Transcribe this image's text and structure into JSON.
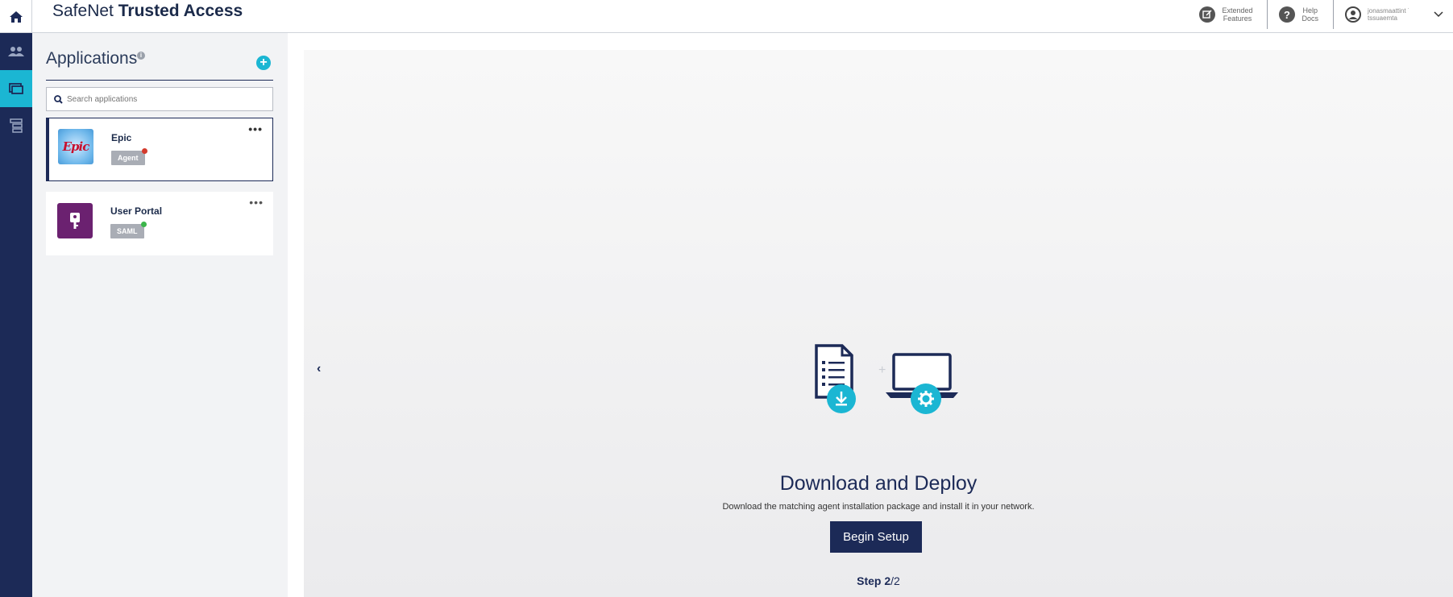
{
  "header": {
    "brand_light": "SafeNet",
    "brand_bold": "Trusted Access",
    "extended_features_line1": "Extended",
    "extended_features_line2": "Features",
    "help_docs_line1": "Help",
    "help_docs_line2": "Docs",
    "user_line1": "jonasmaattint ˙",
    "user_line2": "tssuaemta",
    "icons": [
      "home-icon",
      "external-edit-icon",
      "help-icon",
      "user-avatar-icon",
      "chevron-down-icon"
    ]
  },
  "rail": {
    "items": [
      {
        "name": "users-icon",
        "active": false
      },
      {
        "name": "applications-icon",
        "active": true
      },
      {
        "name": "policies-icon",
        "active": false
      }
    ]
  },
  "sidebar": {
    "title": "Applications",
    "info_glyph": "i",
    "add_glyph": "+",
    "search_placeholder": "Search applications",
    "apps": [
      {
        "name": "Epic",
        "badge": "Agent",
        "status_color": "#d33a2c",
        "logo_text": "Epic",
        "selected": true,
        "more": "•••"
      },
      {
        "name": "User Portal",
        "badge": "SAML",
        "status_color": "#3bb54a",
        "logo_text": "",
        "selected": false,
        "more": "•••"
      }
    ]
  },
  "main": {
    "prev_glyph": "‹",
    "title": "Download and Deploy",
    "description": "Download the matching agent installation package and install it in your network.",
    "begin_button": "Begin Setup",
    "step_label": "Step 2",
    "step_total": "/2",
    "plus_glyph": "+"
  },
  "colors": {
    "navy": "#1c2a57",
    "accent": "#1bb6d3",
    "badge_gray": "#a9adb5"
  }
}
